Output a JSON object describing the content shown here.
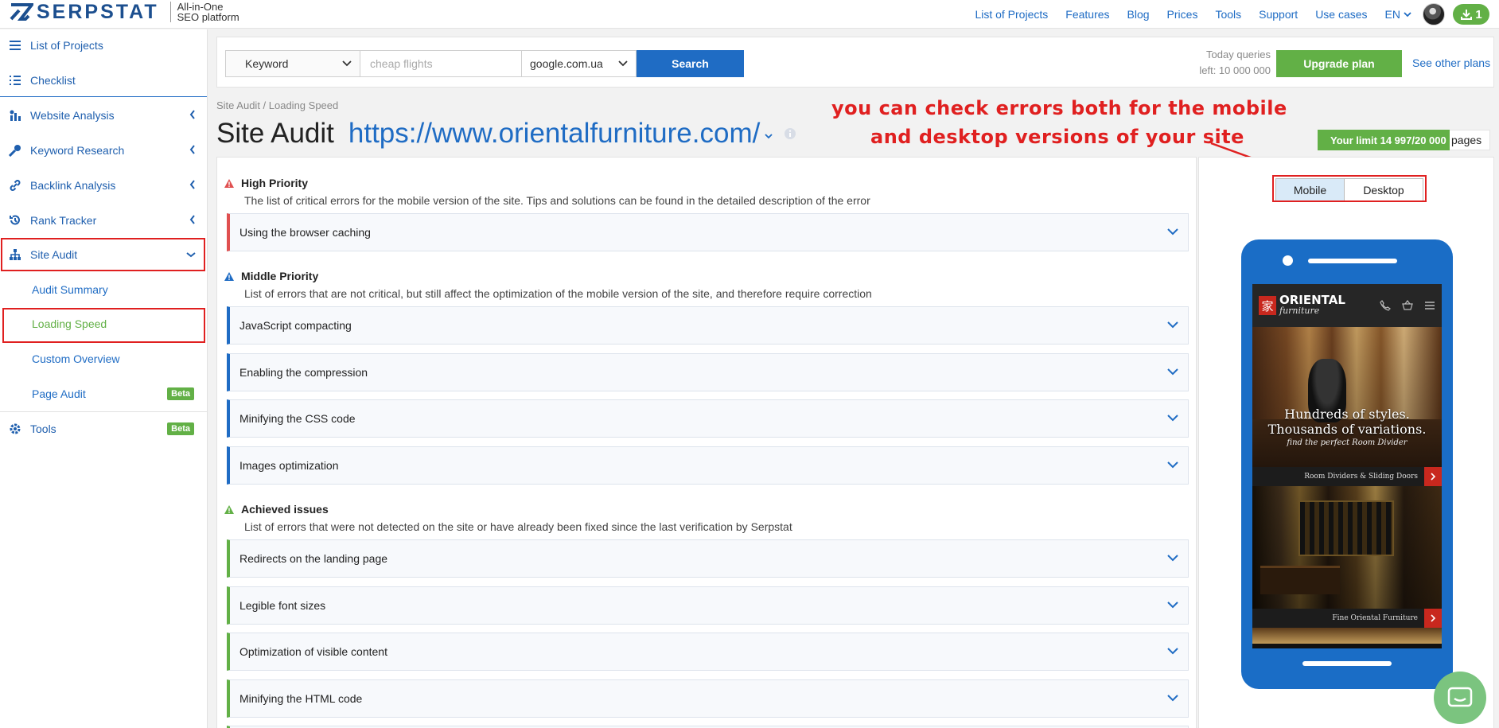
{
  "header": {
    "brand": "SERPSTAT",
    "tagline_line1": "All-in-One",
    "tagline_line2": "SEO platform",
    "nav": [
      "List of Projects",
      "Features",
      "Blog",
      "Prices",
      "Tools",
      "Support",
      "Use cases"
    ],
    "language": "EN",
    "downloads_count": "1"
  },
  "sidebar": {
    "items": [
      {
        "label": "List of Projects",
        "icon": "menu-icon"
      },
      {
        "label": "Checklist",
        "icon": "checklist-icon"
      },
      {
        "label": "Website Analysis",
        "icon": "analysis-icon"
      },
      {
        "label": "Keyword Research",
        "icon": "key-icon"
      },
      {
        "label": "Backlink Analysis",
        "icon": "link-icon"
      },
      {
        "label": "Rank Tracker",
        "icon": "history-icon"
      },
      {
        "label": "Site Audit",
        "icon": "sitemap-icon"
      }
    ],
    "sub_items": [
      {
        "label": "Audit Summary"
      },
      {
        "label": "Loading Speed",
        "active": true
      },
      {
        "label": "Custom Overview"
      },
      {
        "label": "Page Audit",
        "badge": "Beta"
      }
    ],
    "tools": {
      "label": "Tools",
      "badge": "Beta",
      "icon": "gear-icon"
    }
  },
  "search": {
    "type_value": "Keyword",
    "query_placeholder": "cheap flights",
    "engine_value": "google.com.ua",
    "search_label": "Search",
    "queries_line1": "Today queries",
    "queries_line2": "left: 10 000 000",
    "upgrade_label": "Upgrade plan",
    "see_plans_label": "See other plans"
  },
  "page": {
    "breadcrumb": "Site Audit / Loading Speed",
    "title": "Site Audit",
    "url": "https://www.orientalfurniture.com/",
    "limit_text": "Your limit 14 997/20 000",
    "limit_unit": "pages"
  },
  "annotation": {
    "line1": "you can check errors both for the mobile",
    "line2": "and desktop versions of your site"
  },
  "sections": {
    "high": {
      "title": "High Priority",
      "desc": "The list of critical errors for the mobile version of the site. Tips and solutions can be found in the detailed description of the error",
      "rows": [
        "Using the browser caching"
      ]
    },
    "middle": {
      "title": "Middle Priority",
      "desc": "List of errors that are not critical, but still affect the optimization of the mobile version of the site, and therefore require correction",
      "rows": [
        "JavaScript compacting",
        "Enabling the compression",
        "Minifying the CSS code",
        "Images optimization"
      ]
    },
    "achieved": {
      "title": "Achieved issues",
      "desc": "List of errors that were not detected on the site or have already been fixed since the last verification by Serpstat",
      "rows": [
        "Redirects on the landing page",
        "Legible font sizes",
        "Optimization of visible content",
        "Minifying the HTML code"
      ]
    }
  },
  "preview": {
    "mobile_label": "Mobile",
    "desktop_label": "Desktop",
    "site_seal": "家",
    "site_brand": "ORIENTAL",
    "site_brand_sub": "furniture",
    "hero_line1": "Hundreds of styles.",
    "hero_line2": "Thousands of variations.",
    "hero_sub": "find the perfect Room Divider",
    "bar1": "Room Dividers & Sliding Doors",
    "bar2": "Fine Oriental Furniture"
  },
  "colors": {
    "brand_blue": "#1f6cc4",
    "green": "#62b046",
    "red_annotation": "#e02020"
  }
}
